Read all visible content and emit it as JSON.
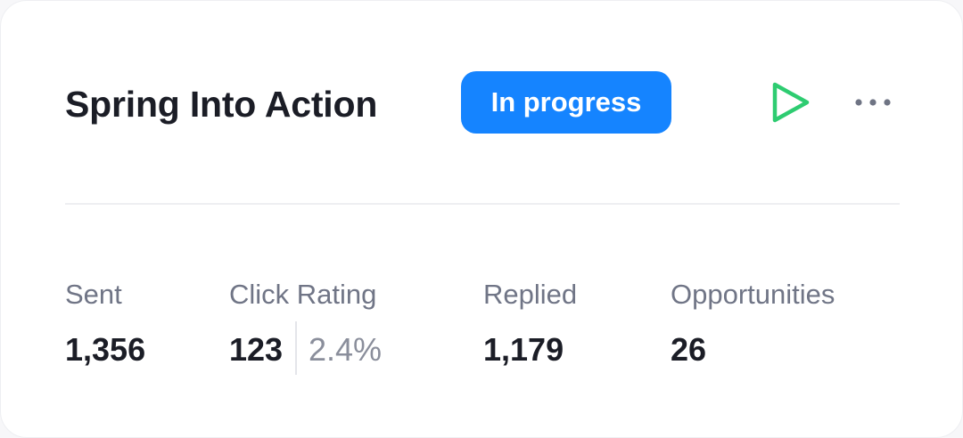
{
  "campaign": {
    "title": "Spring Into Action",
    "status": "In progress",
    "status_color": "#1584ff",
    "play_icon": "play-icon",
    "play_color": "#2ecc71",
    "more_icon": "more-horizontal-icon"
  },
  "stats": {
    "sent": {
      "label": "Sent",
      "value": "1,356"
    },
    "click_rating": {
      "label": "Click Rating",
      "value": "123",
      "rate": "2.4%"
    },
    "replied": {
      "label": "Replied",
      "value": "1,179"
    },
    "opportunities": {
      "label": "Opportunities",
      "value": "26"
    }
  }
}
